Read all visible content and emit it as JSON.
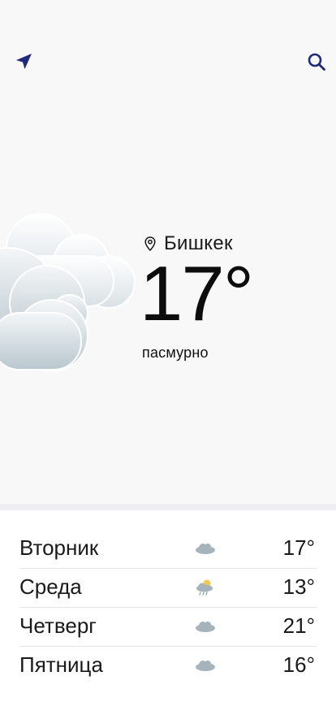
{
  "header": {
    "location_icon": "navigation-arrow-icon",
    "search_icon": "search-icon"
  },
  "current": {
    "city": "Бишкек",
    "temperature": "17°",
    "condition": "пасмурно",
    "icon": "cloudy-icon"
  },
  "forecast": [
    {
      "day": "Вторник",
      "icon": "cloud-icon",
      "temp": "17°"
    },
    {
      "day": "Среда",
      "icon": "cloud-sun-rain-icon",
      "temp": "13°"
    },
    {
      "day": "Четверг",
      "icon": "cloud-icon",
      "temp": "21°"
    },
    {
      "day": "Пятница",
      "icon": "cloud-icon",
      "temp": "16°"
    }
  ],
  "colors": {
    "accent": "#1f2a7a",
    "hero_background": "#f8f8f9",
    "divider": "#efeff1"
  }
}
